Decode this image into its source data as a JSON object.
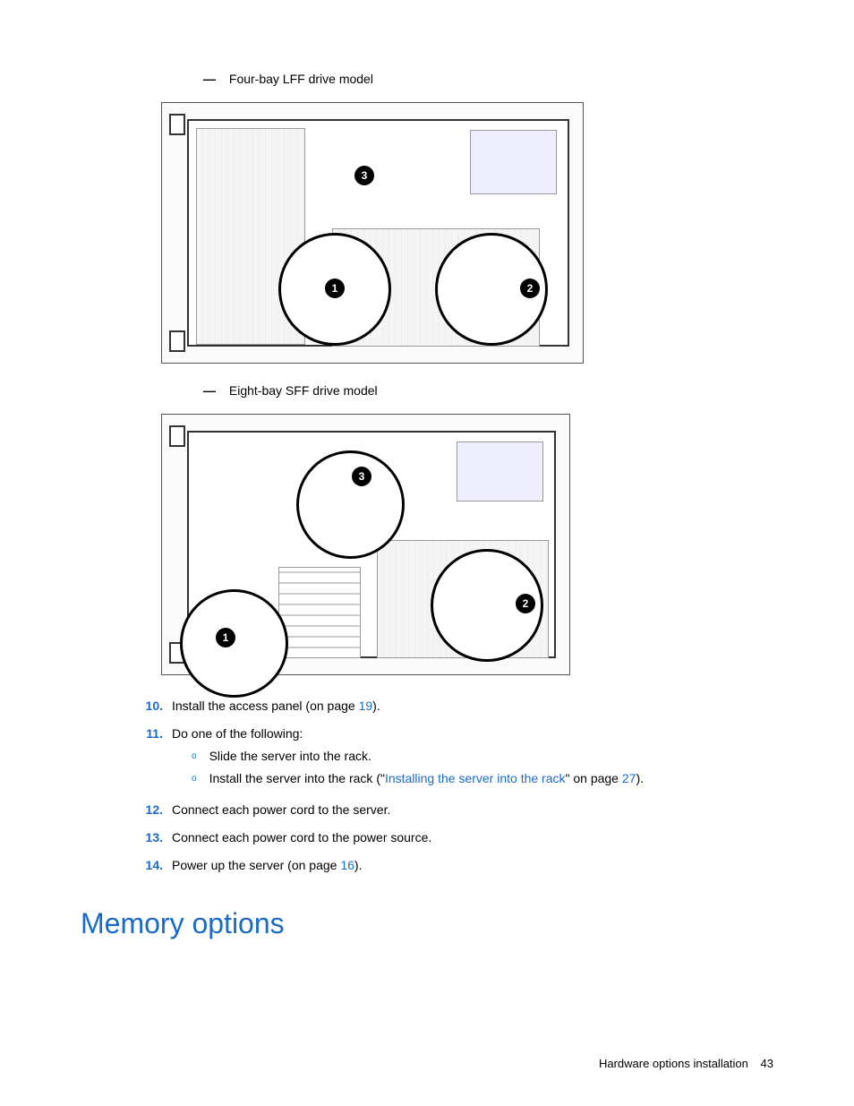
{
  "captions": {
    "figure1": "Four-bay LFF drive model",
    "figure2": "Eight-bay SFF drive model"
  },
  "diagram1": {
    "callouts": [
      "1",
      "2",
      "3"
    ]
  },
  "diagram2": {
    "callouts": [
      "1",
      "2",
      "3"
    ]
  },
  "steps": [
    {
      "num": "10.",
      "text_pre": "Install the access panel (on page ",
      "link": "19",
      "text_post": ")."
    },
    {
      "num": "11.",
      "text_pre": "Do one of the following:",
      "sub": [
        {
          "text_pre": "Slide the server into the rack."
        },
        {
          "text_pre": "Install the server into the rack (\"",
          "link1": "Installing the server into the rack",
          "text_mid": "\" on page ",
          "link2": "27",
          "text_post": ")."
        }
      ]
    },
    {
      "num": "12.",
      "text_pre": "Connect each power cord to the server."
    },
    {
      "num": "13.",
      "text_pre": "Connect each power cord to the power source."
    },
    {
      "num": "14.",
      "text_pre": "Power up the server (on page ",
      "link": "16",
      "text_post": ")."
    }
  ],
  "heading": "Memory options",
  "footer": {
    "section": "Hardware options installation",
    "page": "43"
  }
}
